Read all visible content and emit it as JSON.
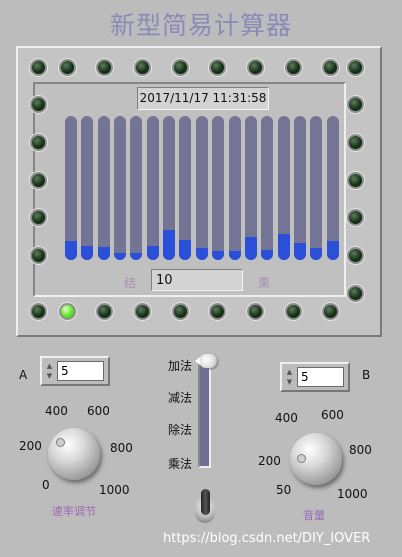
{
  "app": {
    "title": "新型简易计算器"
  },
  "display": {
    "datetime": "2017/11/17 11:31:58",
    "result_label_left": "结",
    "result_label_right": "果",
    "result_value": "10"
  },
  "bars": {
    "fill_color": "#2a4fd8",
    "track_color": "#747494",
    "levels": [
      0.13,
      0.1,
      0.09,
      0.05,
      0.05,
      0.1,
      0.21,
      0.14,
      0.08,
      0.06,
      0.06,
      0.16,
      0.07,
      0.18,
      0.12,
      0.08,
      0.13
    ]
  },
  "leds": {
    "on_index": 1,
    "on_color": "#6eea3c",
    "off_color": "#163316"
  },
  "input_a": {
    "label": "A",
    "value": "5"
  },
  "input_b": {
    "label": "B",
    "value": "5"
  },
  "knob_speed": {
    "ticks": [
      "0",
      "200",
      "400",
      "600",
      "800",
      "1000"
    ],
    "caption": "速率调节"
  },
  "knob_volume": {
    "ticks": [
      "50",
      "200",
      "400",
      "600",
      "800",
      "1000"
    ],
    "caption": "音量"
  },
  "operator_slider": {
    "options": [
      "加法",
      "减法",
      "除法",
      "乘法"
    ],
    "selected": "加法"
  },
  "watermark": "https://blog.csdn.net/DIY_IOVER"
}
